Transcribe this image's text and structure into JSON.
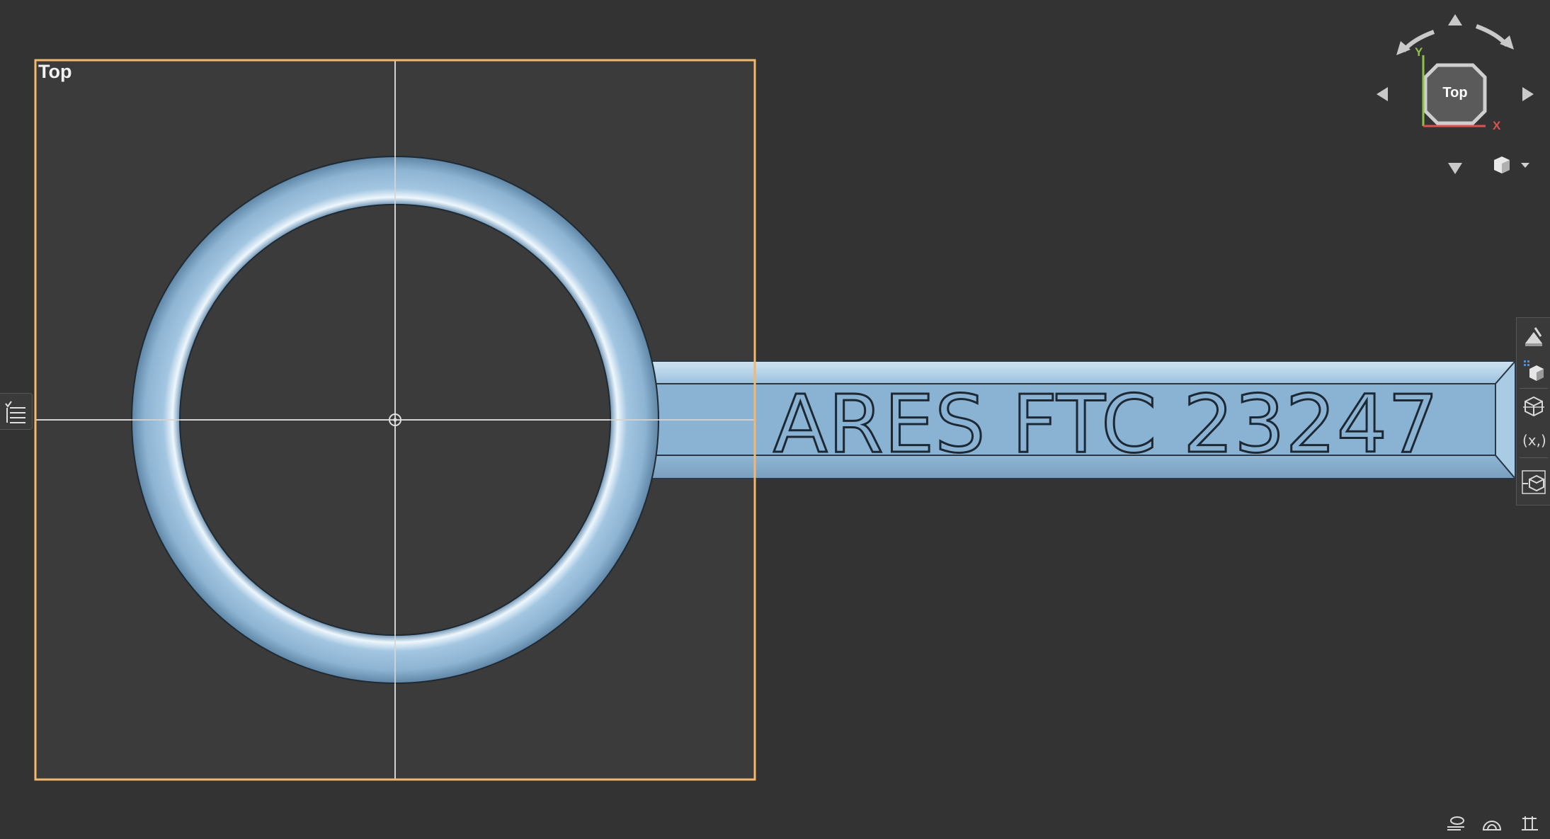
{
  "viewport": {
    "label": "Top",
    "model_text": "ARES FTC 23247"
  },
  "view_cube": {
    "face_label": "Top",
    "axis_y": "Y",
    "axis_x": "X"
  },
  "toolbar": {
    "icons": [
      "render-style-icon",
      "display-mode-icon",
      "section-view-icon",
      "measure-coordinates-icon",
      "view-orientation-icon"
    ]
  },
  "status_bar": {
    "icons": [
      "grid-snap-icon",
      "dome-icon",
      "units-icon"
    ]
  },
  "colors": {
    "background": "#333333",
    "viewport_frame": "#f2b870",
    "model_body": "#8fb6d5",
    "model_highlight": "#e4f1fb",
    "model_shadow": "#5d84a3",
    "axis_y": "#8fc14a",
    "axis_x": "#d9534f"
  }
}
